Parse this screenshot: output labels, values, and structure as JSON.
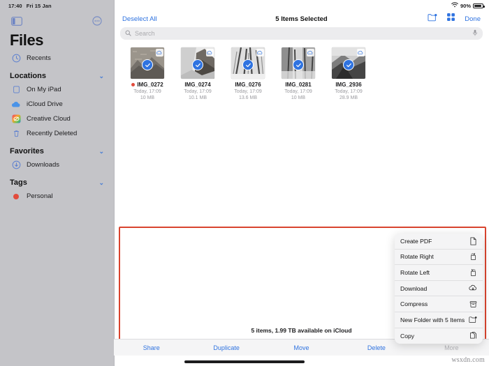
{
  "status_bar": {
    "time": "17:40",
    "date": "Fri 15 Jan",
    "wifi_icon": "wifi-icon",
    "battery_percent": "90%",
    "battery_icon": "battery-icon"
  },
  "sidebar": {
    "toggle_icon": "sidebar-toggle-icon",
    "more_icon": "ellipsis-circle-icon",
    "title": "Files",
    "recents": {
      "label": "Recents",
      "icon": "clock-icon"
    },
    "sections": [
      {
        "title": "Locations",
        "chevron": "⌄",
        "items": [
          {
            "label": "On My iPad",
            "icon": "ipad-icon"
          },
          {
            "label": "iCloud Drive",
            "icon": "icloud-icon"
          },
          {
            "label": "Creative Cloud",
            "icon": "creative-cloud-icon"
          },
          {
            "label": "Recently Deleted",
            "icon": "trash-icon"
          }
        ]
      },
      {
        "title": "Favorites",
        "chevron": "⌄",
        "items": [
          {
            "label": "Downloads",
            "icon": "download-circle-icon"
          }
        ]
      },
      {
        "title": "Tags",
        "chevron": "⌄",
        "items": [
          {
            "label": "Personal",
            "icon": "red-dot-icon"
          }
        ]
      }
    ]
  },
  "toolbar": {
    "deselect_all": "Deselect All",
    "title": "5 Items Selected",
    "new_folder_icon": "new-folder-icon",
    "grid_view_icon": "grid-view-icon",
    "done": "Done"
  },
  "search": {
    "placeholder": "Search",
    "search_icon": "search-icon",
    "mic_icon": "microphone-icon"
  },
  "files": [
    {
      "name": "IMG_0272",
      "date": "Today, 17:09",
      "size": "10 MB",
      "tag": "red",
      "selected": true,
      "cloud_badge": "icloud-download-icon"
    },
    {
      "name": "IMG_0274",
      "date": "Today, 17:09",
      "size": "10.1 MB",
      "tag": "",
      "selected": true,
      "cloud_badge": "icloud-download-icon"
    },
    {
      "name": "IMG_0276",
      "date": "Today, 17:09",
      "size": "13.6 MB",
      "tag": "",
      "selected": true,
      "cloud_badge": "icloud-download-icon"
    },
    {
      "name": "IMG_0281",
      "date": "Today, 17:09",
      "size": "10 MB",
      "tag": "",
      "selected": true,
      "cloud_badge": "icloud-download-icon"
    },
    {
      "name": "IMG_2936",
      "date": "Today, 17:09",
      "size": "28.9 MB",
      "tag": "",
      "selected": true,
      "cloud_badge": "icloud-download-icon"
    }
  ],
  "context_menu": [
    {
      "label": "Create PDF",
      "icon": "document-icon"
    },
    {
      "label": "Rotate Right",
      "icon": "rotate-right-icon"
    },
    {
      "label": "Rotate Left",
      "icon": "rotate-left-icon"
    },
    {
      "label": "Download",
      "icon": "cloud-download-icon"
    },
    {
      "label": "Compress",
      "icon": "archive-box-icon"
    },
    {
      "label": "New Folder with 5 Items",
      "icon": "new-folder-icon"
    },
    {
      "label": "Copy",
      "icon": "copy-icon"
    }
  ],
  "footer": {
    "items_info": "5 items, 1.99 TB available on iCloud",
    "actions": [
      {
        "label": "Share",
        "disabled": false
      },
      {
        "label": "Duplicate",
        "disabled": false
      },
      {
        "label": "Move",
        "disabled": false
      },
      {
        "label": "Delete",
        "disabled": false
      },
      {
        "label": "More",
        "disabled": true
      }
    ]
  },
  "annotation": {
    "highlight_color": "#d9442e"
  },
  "watermark": "wsxdn.com",
  "colors": {
    "accent": "#2f73e0",
    "sidebar_bg": "#c4c4c8",
    "menu_bg": "#f4f4f5"
  }
}
